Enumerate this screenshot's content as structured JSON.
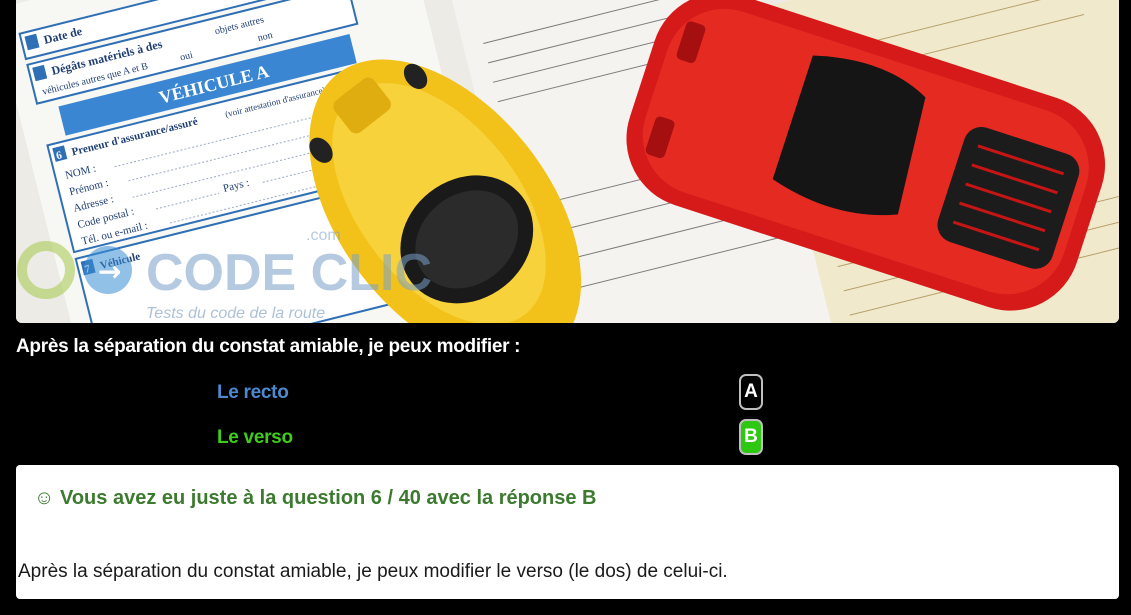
{
  "photo": {
    "form": {
      "section_date": "Date de",
      "section_degats": "Dégâts matériels à des",
      "vehicules_autres": "véhicules autres que A et B",
      "objets_autres": "objets autres",
      "oui": "oui",
      "non": "non",
      "vehicule_header": "VÉHICULE A",
      "preneur": "Preneur d'assurance/assuré",
      "preneur_note": "(voir attestation d'assurance)",
      "nom": "NOM :",
      "prenom": "Prénom :",
      "adresse": "Adresse :",
      "code_postal": "Code postal :",
      "pays": "Pays :",
      "tel": "Tél. ou e-mail :",
      "vehicule": "Véhicule",
      "num_6": "6",
      "num_7": "7"
    },
    "watermark": {
      "brand": "CODE CLIC",
      "domain": ".com",
      "tagline": "Tests du code de la route"
    }
  },
  "question": {
    "text": "Après la séparation du constat amiable, je peux modifier :"
  },
  "answers": [
    {
      "label": "Le recto",
      "key": "A",
      "color": "#4d89d1"
    },
    {
      "label": "Le verso",
      "key": "B",
      "color": "#3fcc1a"
    }
  ],
  "result": {
    "title": "☺ Vous avez eu juste à la question 6 / 40 avec la réponse B",
    "explanation": "Après la séparation du constat amiable, je peux modifier le verso (le dos) de celui-ci."
  }
}
